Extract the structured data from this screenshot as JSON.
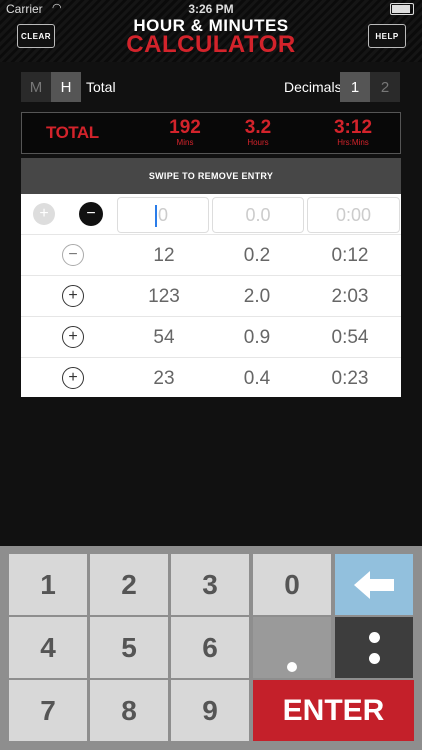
{
  "status": {
    "carrier": "Carrier",
    "time": "3:26 PM"
  },
  "header": {
    "clear": "CLEAR",
    "help": "HELP",
    "title_line1": "HOUR & MINUTES",
    "title_line2": "CALCULATOR"
  },
  "mode": {
    "m": "M",
    "h": "H",
    "label": "Total",
    "selected": "H"
  },
  "decimals": {
    "label": "Decimals",
    "opt1": "1",
    "opt2": "2",
    "selected": "1"
  },
  "totals": {
    "label": "TOTAL",
    "mins": {
      "value": "192",
      "unit": "Mins"
    },
    "hours": {
      "value": "3.2",
      "unit": "Hours"
    },
    "hrsmins": {
      "value": "3:12",
      "unit": "Hrs:Mins"
    }
  },
  "swipe_text": "SWIPE TO REMOVE ENTRY",
  "input_row": {
    "mins_placeholder": "0",
    "hours_placeholder": "0.0",
    "hrsmins_placeholder": "0:00"
  },
  "entries": [
    {
      "sign": "−",
      "mins": "12",
      "hours": "0.2",
      "hrsmins": "0:12"
    },
    {
      "sign": "+",
      "mins": "123",
      "hours": "2.0",
      "hrsmins": "2:03"
    },
    {
      "sign": "+",
      "mins": "54",
      "hours": "0.9",
      "hrsmins": "0:54"
    },
    {
      "sign": "+",
      "mins": "23",
      "hours": "0.4",
      "hrsmins": "0:23"
    }
  ],
  "keypad": {
    "k1": "1",
    "k2": "2",
    "k3": "3",
    "k0": "0",
    "k4": "4",
    "k5": "5",
    "k6": "6",
    "k7": "7",
    "k8": "8",
    "k9": "9",
    "enter": "ENTER"
  },
  "icons": {
    "back": "backspace-arrow-icon",
    "dot": "decimal-point-icon",
    "colon": "colon-icon"
  },
  "colors": {
    "accent_red": "#d3232b",
    "enter_red": "#c4202a",
    "back_blue": "#92c0dd"
  }
}
